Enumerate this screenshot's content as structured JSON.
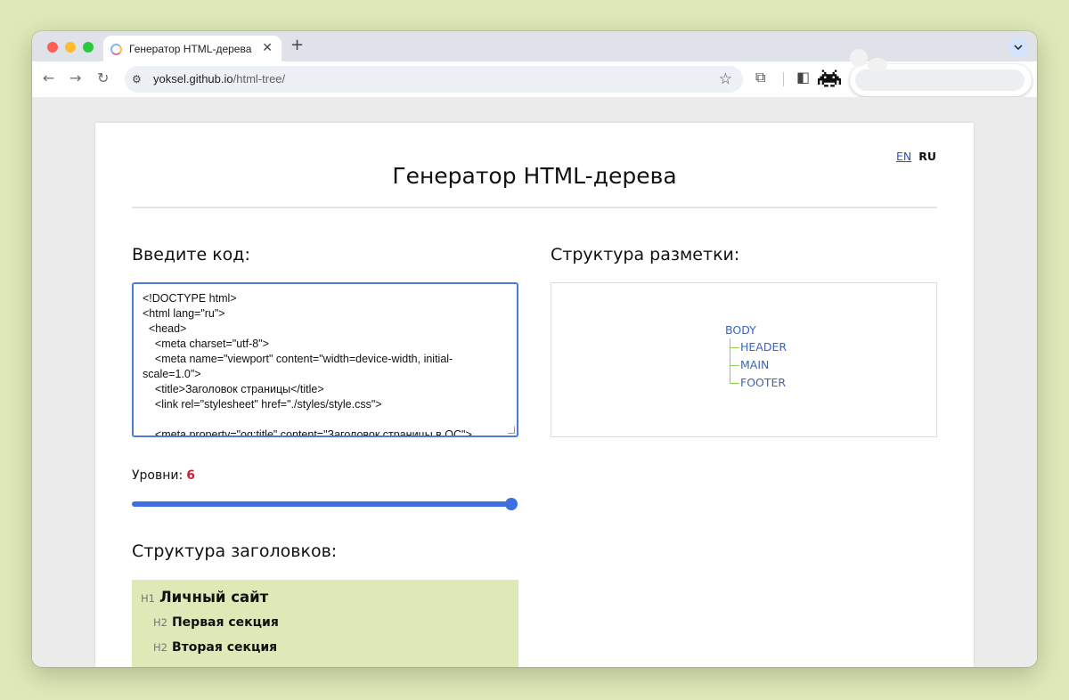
{
  "browser": {
    "tab_title": "Генератор HTML-дерева",
    "tab_close": "✕",
    "new_tab": "+",
    "url_host": "yoksel.github.io",
    "url_path": "/html-tree/"
  },
  "page": {
    "lang_en": "EN",
    "lang_ru": "RU",
    "title": "Генератор HTML-дерева",
    "input_heading": "Введите код:",
    "code": "<!DOCTYPE html>\n<html lang=\"ru\">\n  <head>\n    <meta charset=\"utf-8\">\n    <meta name=\"viewport\" content=\"width=device-width, initial-scale=1.0\">\n    <title>Заголовок страницы</title>\n    <link rel=\"stylesheet\" href=\"./styles/style.css\">\n\n    <meta property=\"og:title\" content=\"Заголовок страницы в ОС\">",
    "structure_heading": "Структура разметки:",
    "tree": {
      "root": "BODY",
      "children": [
        "HEADER",
        "MAIN",
        "FOOTER"
      ]
    },
    "levels_label": "Уровни:",
    "levels_value": "6",
    "slider_value": 6,
    "headings_heading": "Структура заголовков:",
    "headings": [
      {
        "tag": "H1",
        "text": "Личный сайт"
      },
      {
        "tag": "H2",
        "text": "Первая секция"
      },
      {
        "tag": "H2",
        "text": "Вторая секция"
      }
    ]
  }
}
